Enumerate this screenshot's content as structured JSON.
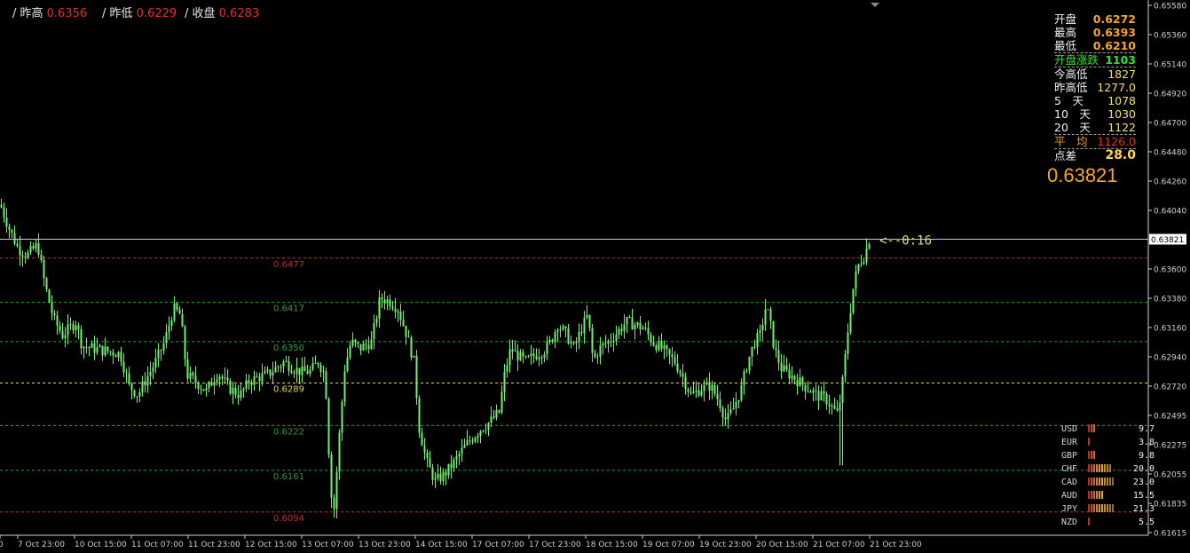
{
  "header": {
    "prev_high_label": "/ 昨高",
    "prev_high_value": "0.6356",
    "prev_low_label": "/ 昨低",
    "prev_low_value": "0.6229",
    "close_label": "/ 收盘",
    "close_value": "0.6283"
  },
  "panel": {
    "open_label": "开盘",
    "open_value": "0.6272",
    "high_label": "最高",
    "high_value": "0.6393",
    "low_label": "最低",
    "low_value": "0.6210",
    "open_change_label": "开盘涨跌",
    "open_change_value": "1103",
    "today_range_label": "今高低",
    "today_range_value": "1827",
    "prev_range_label": "昨高低",
    "prev_range_value": "1277.0",
    "d5_label": "5　天",
    "d5_value": "1078",
    "d10_label": "10　天",
    "d10_value": "1030",
    "d20_label": "20　天",
    "d20_value": "1122",
    "avg_label": "平　均",
    "avg_value": "1126.0",
    "spread_label": "点差",
    "spread_value": "28.0",
    "current_price": "0.63821"
  },
  "strength": [
    {
      "currency": "USD",
      "value": "9.7",
      "n": 3
    },
    {
      "currency": "EUR",
      "value": "3.8",
      "n": 1
    },
    {
      "currency": "GBP",
      "value": "9.8",
      "n": 3
    },
    {
      "currency": "CHF",
      "value": "20.0",
      "n": 9
    },
    {
      "currency": "CAD",
      "value": "23.0",
      "n": 10
    },
    {
      "currency": "AUD",
      "value": "15.5",
      "n": 6
    },
    {
      "currency": "JPY",
      "value": "21.3",
      "n": 10
    },
    {
      "currency": "NZD",
      "value": "5.5",
      "n": 1
    }
  ],
  "chart_data": {
    "type": "candlestick",
    "y_ticks": [
      "0.65580",
      "0.65360",
      "0.65140",
      "0.64920",
      "0.64700",
      "0.64480",
      "0.64260",
      "0.64040",
      "0.63600",
      "0.63380",
      "0.63160",
      "0.62940",
      "0.62720",
      "0.62495",
      "0.62275",
      "0.62055",
      "0.61835",
      "0.61615"
    ],
    "ylim": [
      0.61615,
      0.6558
    ],
    "x_ticks": [
      "0",
      "7 Oct 23:00",
      "10 Oct 15:00",
      "11 Oct 07:00",
      "11 Oct 23:00",
      "12 Oct 15:00",
      "13 Oct 07:00",
      "13 Oct 23:00",
      "14 Oct 15:00",
      "17 Oct 07:00",
      "17 Oct 23:00",
      "18 Oct 15:00",
      "19 Oct 07:00",
      "19 Oct 23:00",
      "20 Oct 15:00",
      "21 Oct 07:00",
      "21 Oct 23:00"
    ],
    "current_price": 0.63821,
    "current_price_label": "0.63821",
    "countdown_label": "<--0:16",
    "levels": [
      {
        "label": "0.6477",
        "price": 0.63679,
        "color": "#c0302a"
      },
      {
        "label": "0.6417",
        "price": 0.63346,
        "color": "#2f9a3a"
      },
      {
        "label": "0.6350",
        "price": 0.63051,
        "color": "#2f9a3a"
      },
      {
        "label": "0.6289",
        "price": 0.6274,
        "color": "#e8d84a"
      },
      {
        "label": "0.6222",
        "price": 0.6242,
        "color": "#2f9a3a"
      },
      {
        "label": "0.6161",
        "price": 0.62083,
        "color": "#2f9a3a"
      },
      {
        "label": "0.6094",
        "price": 0.6177,
        "color": "#c0302a"
      }
    ],
    "price_path": [
      [
        0,
        0.6408
      ],
      [
        10,
        0.639
      ],
      [
        20,
        0.6375
      ],
      [
        30,
        0.637
      ],
      [
        42,
        0.6378
      ],
      [
        50,
        0.6348
      ],
      [
        60,
        0.6322
      ],
      [
        70,
        0.631
      ],
      [
        85,
        0.632
      ],
      [
        92,
        0.6302
      ],
      [
        105,
        0.63
      ],
      [
        120,
        0.6298
      ],
      [
        135,
        0.6296
      ],
      [
        145,
        0.6272
      ],
      [
        155,
        0.6265
      ],
      [
        165,
        0.6278
      ],
      [
        175,
        0.629
      ],
      [
        185,
        0.6305
      ],
      [
        195,
        0.633
      ],
      [
        203,
        0.6325
      ],
      [
        210,
        0.628
      ],
      [
        220,
        0.6275
      ],
      [
        232,
        0.6268
      ],
      [
        245,
        0.6282
      ],
      [
        258,
        0.627
      ],
      [
        270,
        0.6265
      ],
      [
        280,
        0.6275
      ],
      [
        290,
        0.6278
      ],
      [
        300,
        0.628
      ],
      [
        310,
        0.6285
      ],
      [
        320,
        0.629
      ],
      [
        330,
        0.6285
      ],
      [
        340,
        0.6282
      ],
      [
        350,
        0.6283
      ],
      [
        358,
        0.629
      ],
      [
        366,
        0.628
      ],
      [
        372,
        0.6195
      ],
      [
        376,
        0.618
      ],
      [
        382,
        0.6235
      ],
      [
        388,
        0.6285
      ],
      [
        395,
        0.6305
      ],
      [
        405,
        0.63
      ],
      [
        418,
        0.6305
      ],
      [
        428,
        0.6338
      ],
      [
        440,
        0.6335
      ],
      [
        448,
        0.633
      ],
      [
        458,
        0.631
      ],
      [
        466,
        0.629
      ],
      [
        472,
        0.624
      ],
      [
        480,
        0.6215
      ],
      [
        490,
        0.62
      ],
      [
        500,
        0.6205
      ],
      [
        512,
        0.6215
      ],
      [
        522,
        0.6225
      ],
      [
        532,
        0.6233
      ],
      [
        542,
        0.624
      ],
      [
        552,
        0.6245
      ],
      [
        562,
        0.6252
      ],
      [
        568,
        0.628
      ],
      [
        575,
        0.63
      ],
      [
        582,
        0.6295
      ],
      [
        592,
        0.629
      ],
      [
        602,
        0.6295
      ],
      [
        612,
        0.6298
      ],
      [
        620,
        0.6305
      ],
      [
        628,
        0.6318
      ],
      [
        638,
        0.631
      ],
      [
        646,
        0.63
      ],
      [
        655,
        0.6315
      ],
      [
        662,
        0.6325
      ],
      [
        668,
        0.629
      ],
      [
        675,
        0.63
      ],
      [
        685,
        0.6305
      ],
      [
        695,
        0.6312
      ],
      [
        705,
        0.632
      ],
      [
        715,
        0.6318
      ],
      [
        725,
        0.6315
      ],
      [
        735,
        0.6305
      ],
      [
        745,
        0.63
      ],
      [
        752,
        0.6295
      ],
      [
        760,
        0.629
      ],
      [
        768,
        0.628
      ],
      [
        778,
        0.6265
      ],
      [
        790,
        0.627
      ],
      [
        800,
        0.6272
      ],
      [
        810,
        0.626
      ],
      [
        818,
        0.6245
      ],
      [
        826,
        0.6255
      ],
      [
        835,
        0.627
      ],
      [
        842,
        0.629
      ],
      [
        850,
        0.6305
      ],
      [
        856,
        0.631
      ],
      [
        862,
        0.633
      ],
      [
        866,
        0.6325
      ],
      [
        872,
        0.63
      ],
      [
        880,
        0.6285
      ],
      [
        890,
        0.628
      ],
      [
        900,
        0.6275
      ],
      [
        910,
        0.627
      ],
      [
        920,
        0.6265
      ],
      [
        930,
        0.6262
      ],
      [
        938,
        0.6255
      ],
      [
        944,
        0.625
      ],
      [
        950,
        0.628
      ],
      [
        956,
        0.632
      ],
      [
        962,
        0.635
      ],
      [
        968,
        0.6365
      ],
      [
        974,
        0.637
      ],
      [
        979,
        0.6382
      ]
    ]
  }
}
